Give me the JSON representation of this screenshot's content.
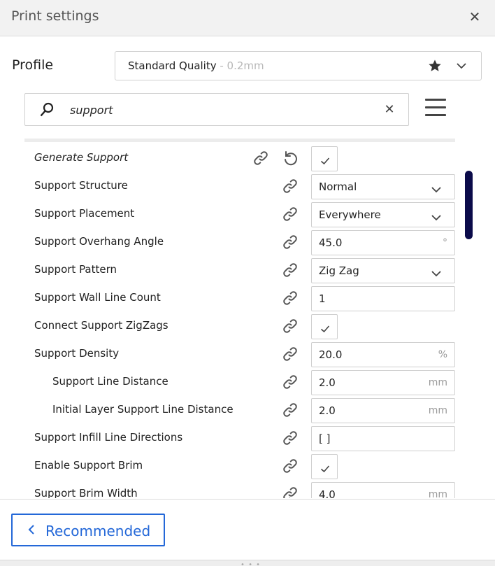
{
  "window": {
    "title": "Print settings"
  },
  "profile": {
    "label": "Profile",
    "name": "Standard Quality",
    "sub": " - 0.2mm"
  },
  "search": {
    "value": "support"
  },
  "settings": [
    {
      "label": "Generate Support",
      "control": "check",
      "checked": true,
      "italic": true,
      "reset": true
    },
    {
      "label": "Support Structure",
      "control": "select",
      "value": "Normal"
    },
    {
      "label": "Support Placement",
      "control": "select",
      "value": "Everywhere"
    },
    {
      "label": "Support Overhang Angle",
      "control": "number",
      "value": "45.0",
      "unit": "°"
    },
    {
      "label": "Support Pattern",
      "control": "select",
      "value": "Zig Zag"
    },
    {
      "label": "Support Wall Line Count",
      "control": "number",
      "value": "1",
      "unit": ""
    },
    {
      "label": "Connect Support ZigZags",
      "control": "check",
      "checked": true
    },
    {
      "label": "Support Density",
      "control": "number",
      "value": "20.0",
      "unit": "%"
    },
    {
      "label": "Support Line Distance",
      "control": "number",
      "value": "2.0",
      "unit": "mm",
      "indent": true
    },
    {
      "label": "Initial Layer Support Line Distance",
      "control": "number",
      "value": "2.0",
      "unit": "mm",
      "indent": true
    },
    {
      "label": "Support Infill Line Directions",
      "control": "text",
      "value": "[ ]",
      "unit": ""
    },
    {
      "label": "Enable Support Brim",
      "control": "check",
      "checked": true
    },
    {
      "label": "Support Brim Width",
      "control": "number",
      "value": "4.0",
      "unit": "mm"
    }
  ],
  "footer": {
    "recommended_label": "Recommended"
  },
  "icons": {
    "close": "close-icon",
    "star": "star-icon",
    "chevron": "chevron-down-icon",
    "search": "search-icon",
    "menu": "hamburger-menu-icon",
    "link": "link-icon",
    "reset": "reset-icon",
    "check": "check-icon",
    "back": "chevron-left-icon"
  },
  "colors": {
    "accent": "#2468d8",
    "scrollbar": "#0b0b4a",
    "unit_gray": "#999999"
  }
}
